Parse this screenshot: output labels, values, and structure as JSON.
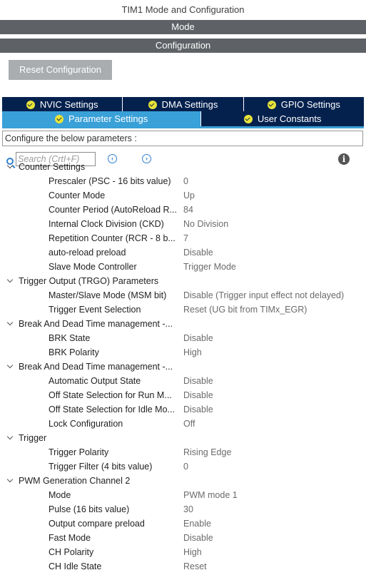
{
  "window_title": "TIM1 Mode and Configuration",
  "mode_bar": "Mode",
  "config_bar": "Configuration",
  "reset_button": "Reset Configuration",
  "tabs_row1": [
    "NVIC Settings",
    "DMA Settings",
    "GPIO Settings"
  ],
  "tabs_row2": [
    "Parameter Settings",
    "User Constants"
  ],
  "config_hint": "Configure the below parameters :",
  "search": {
    "placeholder": "Search (CrtI+F)"
  },
  "colors": {
    "tab_dark": "#04214e",
    "tab_active": "#39a0d8",
    "bar": "#5e6266",
    "check": "#e7e33a"
  },
  "groups": [
    {
      "label": "Counter Settings",
      "params": [
        {
          "name": "Prescaler (PSC - 16 bits value)",
          "value": "0"
        },
        {
          "name": "Counter Mode",
          "value": "Up"
        },
        {
          "name": "Counter Period (AutoReload R...",
          "value": "84"
        },
        {
          "name": "Internal Clock Division (CKD)",
          "value": "No Division"
        },
        {
          "name": "Repetition Counter (RCR - 8 b...",
          "value": "7"
        },
        {
          "name": "auto-reload preload",
          "value": "Disable"
        },
        {
          "name": "Slave Mode Controller",
          "value": "Trigger Mode"
        }
      ]
    },
    {
      "label": "Trigger Output (TRGO) Parameters",
      "params": [
        {
          "name": "Master/Slave Mode (MSM bit)",
          "value": "Disable (Trigger input effect not delayed)"
        },
        {
          "name": "Trigger Event Selection",
          "value": "Reset (UG bit from TIMx_EGR)"
        }
      ]
    },
    {
      "label": "Break And Dead Time management -...",
      "params": [
        {
          "name": "BRK State",
          "value": "Disable"
        },
        {
          "name": "BRK Polarity",
          "value": "High"
        }
      ]
    },
    {
      "label": "Break And Dead Time management -...",
      "params": [
        {
          "name": "Automatic Output State",
          "value": "Disable"
        },
        {
          "name": "Off State Selection for Run M...",
          "value": "Disable"
        },
        {
          "name": "Off State Selection for Idle Mo...",
          "value": "Disable"
        },
        {
          "name": "Lock Configuration",
          "value": "Off"
        }
      ]
    },
    {
      "label": "Trigger",
      "params": [
        {
          "name": "Trigger Polarity",
          "value": "Rising Edge"
        },
        {
          "name": "Trigger Filter (4 bits value)",
          "value": "0"
        }
      ]
    },
    {
      "label": "PWM Generation Channel 2",
      "params": [
        {
          "name": "Mode",
          "value": "PWM mode 1"
        },
        {
          "name": "Pulse (16 bits value)",
          "value": "30"
        },
        {
          "name": "Output compare preload",
          "value": "Enable"
        },
        {
          "name": "Fast Mode",
          "value": "Disable"
        },
        {
          "name": "CH Polarity",
          "value": "High"
        },
        {
          "name": "CH Idle State",
          "value": "Reset"
        }
      ]
    }
  ]
}
